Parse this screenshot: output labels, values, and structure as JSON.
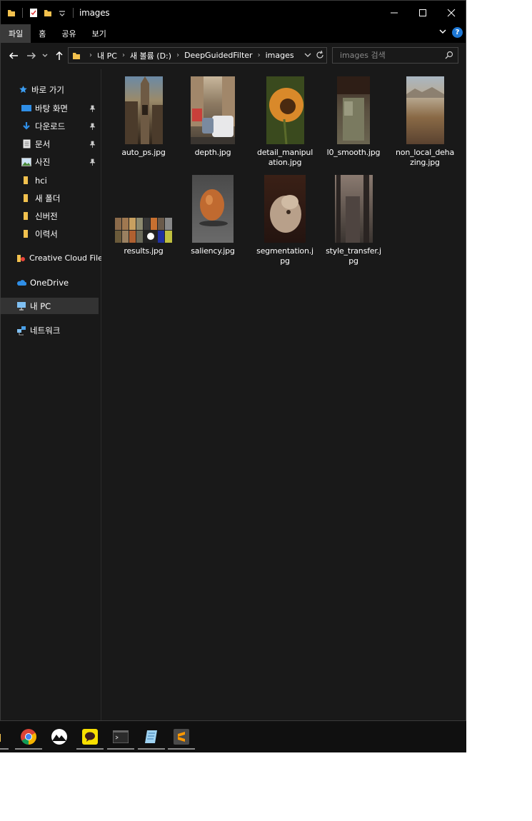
{
  "window": {
    "title": "images"
  },
  "ribbon": {
    "tabs": [
      "파일",
      "홈",
      "공유",
      "보기"
    ],
    "help": "?"
  },
  "address": {
    "crumbs": [
      "내 PC",
      "새 볼륨 (D:)",
      "DeepGuidedFilter",
      "images"
    ]
  },
  "search": {
    "placeholder": "images 검색"
  },
  "sidebar": {
    "quick_access": "바로 가기",
    "pinned": [
      "바탕 화면",
      "다운로드",
      "문서",
      "사진"
    ],
    "folders": [
      "hci",
      "새 폴더",
      "신버전",
      "이력서"
    ],
    "creative_cloud": "Creative Cloud Files",
    "onedrive": "OneDrive",
    "this_pc": "내 PC",
    "network": "네트워크"
  },
  "files": [
    {
      "name": "auto_ps.jpg"
    },
    {
      "name": "depth.jpg"
    },
    {
      "name": "detail_manipulation.jpg"
    },
    {
      "name": "l0_smooth.jpg"
    },
    {
      "name": "non_local_dehazing.jpg"
    },
    {
      "name": "results.jpg"
    },
    {
      "name": "saliency.jpg"
    },
    {
      "name": "segmentation.jpg"
    },
    {
      "name": "style_transfer.jpg"
    }
  ],
  "colors": {
    "accent": "#1e78d6",
    "folder": "#f2c14e",
    "background": "#191919",
    "titlebar": "#000000"
  }
}
